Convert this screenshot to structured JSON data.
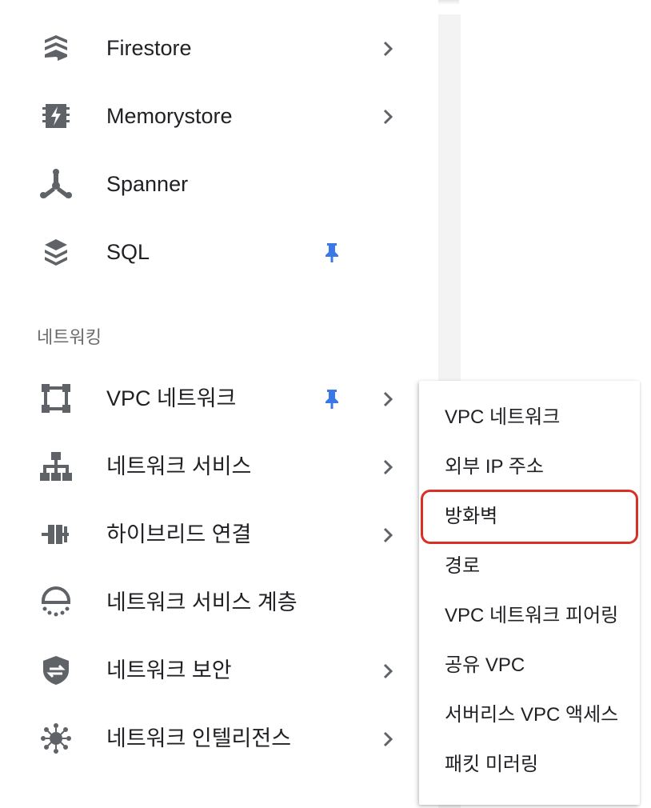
{
  "nav": {
    "items": [
      {
        "label": "Firestore",
        "icon": "firestore-icon",
        "pinned": false,
        "has_submenu": true
      },
      {
        "label": "Memorystore",
        "icon": "memorystore-icon",
        "pinned": false,
        "has_submenu": true
      },
      {
        "label": "Spanner",
        "icon": "spanner-icon",
        "pinned": false,
        "has_submenu": false
      },
      {
        "label": "SQL",
        "icon": "sql-icon",
        "pinned": true,
        "has_submenu": false
      }
    ],
    "section_header": "네트워킹",
    "network_items": [
      {
        "label": "VPC 네트워크",
        "icon": "vpc-network-icon",
        "pinned": true,
        "has_submenu": true
      },
      {
        "label": "네트워크 서비스",
        "icon": "network-services-icon",
        "pinned": false,
        "has_submenu": true
      },
      {
        "label": "하이브리드 연결",
        "icon": "hybrid-connectivity-icon",
        "pinned": false,
        "has_submenu": true
      },
      {
        "label": "네트워크 서비스 계층",
        "icon": "network-service-tiers-icon",
        "pinned": false,
        "has_submenu": false
      },
      {
        "label": "네트워크 보안",
        "icon": "network-security-icon",
        "pinned": false,
        "has_submenu": true
      },
      {
        "label": "네트워크 인텔리전스",
        "icon": "network-intelligence-icon",
        "pinned": false,
        "has_submenu": true
      }
    ]
  },
  "submenu": {
    "items": [
      {
        "label": "VPC 네트워크"
      },
      {
        "label": "외부 IP 주소"
      },
      {
        "label": "방화벽",
        "highlighted": true
      },
      {
        "label": "경로"
      },
      {
        "label": "VPC 네트워크 피어링"
      },
      {
        "label": "공유 VPC"
      },
      {
        "label": "서버리스 VPC 액세스"
      },
      {
        "label": "패킷 미러링"
      }
    ]
  },
  "colors": {
    "pin": "#3b78e7",
    "icon": "#5f6368",
    "highlight": "#d93025",
    "text": "#202124"
  }
}
